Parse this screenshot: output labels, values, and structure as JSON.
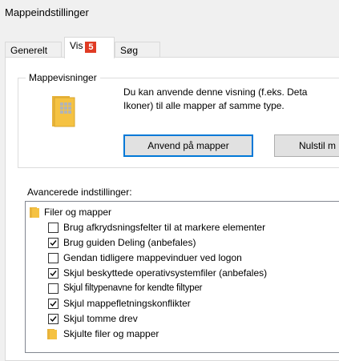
{
  "window": {
    "title": "Mappeindstillinger"
  },
  "tabs": [
    {
      "label": "Generelt",
      "active": false
    },
    {
      "label": "Vis",
      "active": true,
      "badge": "5"
    },
    {
      "label": "Søg",
      "active": false
    }
  ],
  "views": {
    "group_label": "Mappevisninger",
    "description_line1": "Du kan anvende denne visning (f.eks. Deta",
    "description_line2": "Ikoner) til alle mapper af samme type.",
    "apply_button": "Anvend på mapper",
    "reset_button": "Nulstil m"
  },
  "advanced": {
    "label": "Avancerede indstillinger:",
    "items": [
      {
        "type": "folder",
        "label": "Filer og mapper"
      },
      {
        "type": "checkbox",
        "checked": false,
        "label": "Brug afkrydsningsfelter til at markere elementer"
      },
      {
        "type": "checkbox",
        "checked": true,
        "label": "Brug guiden Deling (anbefales)"
      },
      {
        "type": "checkbox",
        "checked": false,
        "label": "Gendan tidligere mappevinduer ved logon"
      },
      {
        "type": "checkbox",
        "checked": true,
        "label": "Skjul beskyttede operativsystemfiler (anbefales)"
      },
      {
        "type": "checkbox",
        "checked": false,
        "label": "Skjul filtypenavne for kendte filtyper"
      },
      {
        "type": "checkbox",
        "checked": true,
        "label": "Skjul mappefletningskonflikter"
      },
      {
        "type": "checkbox",
        "checked": true,
        "label": "Skjul tomme drev"
      },
      {
        "type": "folder",
        "label": "Skjulte filer og mapper"
      }
    ]
  },
  "colors": {
    "badge": "#e03b24",
    "folder": "#f5c242",
    "accent": "#0078d7"
  }
}
